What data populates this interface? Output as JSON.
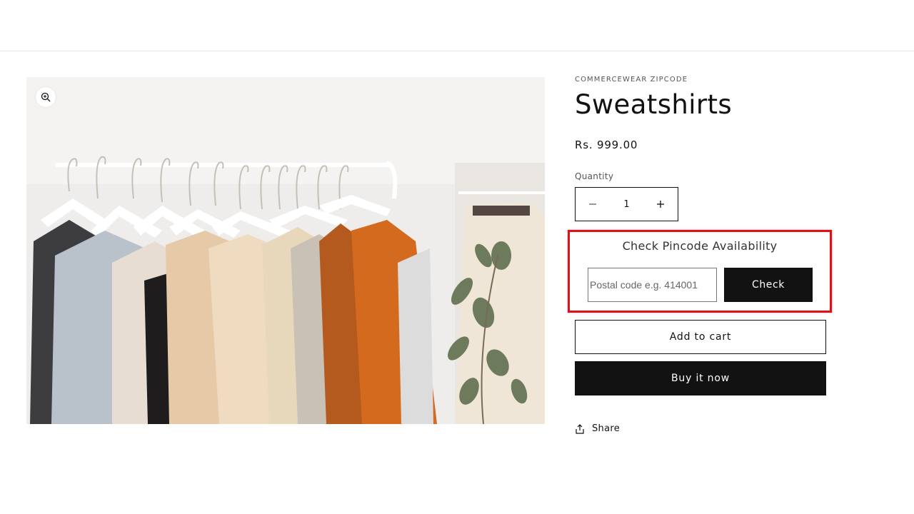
{
  "product": {
    "vendor": "COMMERCEWEAR ZIPCODE",
    "title": "Sweatshirts",
    "price": "Rs. 999.00",
    "image_icon": "zoom-in-icon"
  },
  "quantity": {
    "label": "Quantity",
    "value": "1",
    "decrease_icon": "minus-icon",
    "increase_icon": "plus-icon"
  },
  "pincode": {
    "title": "Check Pincode Availability",
    "placeholder": "Postal code e.g. 414001",
    "value": "",
    "check_label": "Check",
    "highlight_color": "#e01010"
  },
  "actions": {
    "add_to_cart": "Add to cart",
    "buy_now": "Buy it now",
    "share": "Share",
    "share_icon": "share-icon"
  },
  "colors": {
    "primary": "#121212",
    "background": "#ffffff"
  }
}
